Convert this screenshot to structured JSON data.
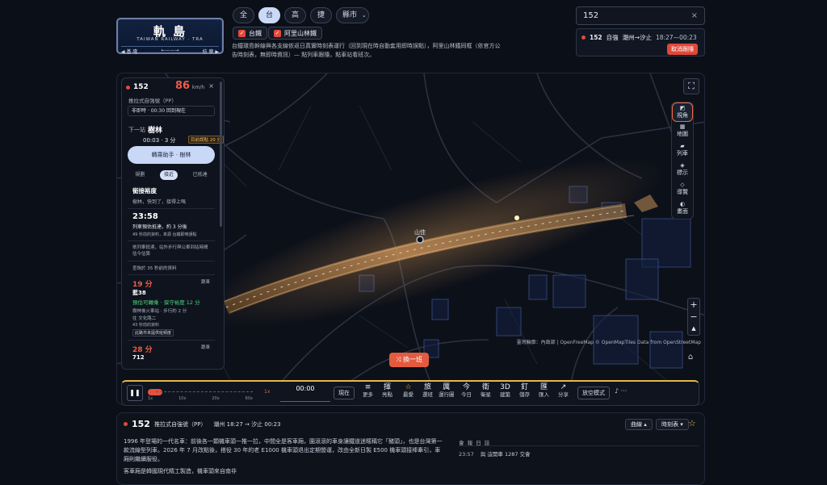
{
  "logo": {
    "title": "軌 島",
    "subtitle": "TAIWAN RAILWAY · TRA",
    "left_station": "◀ 基 隆",
    "arrow": "←——→",
    "right_station": "枋 寮 ▶"
  },
  "filters": {
    "all": "全",
    "tra": "台",
    "hsr": "高",
    "metro": "捷",
    "city": "縣市",
    "city_icon": "chevron-down"
  },
  "checks": {
    "tra": "台鐵",
    "alishan": "阿里山林鐵"
  },
  "description": "台鐵環島幹線與各支線依返日真實時刻表運行（回到現在時自動套用即時誤點），阿里山林鐵同框（依官方公告時刻表，無即時資訊）— 點列車跟隨，點車站看班次。",
  "search": {
    "value": "152",
    "clear": "×"
  },
  "result": {
    "train": "152",
    "type": "自強",
    "route": "潮州→汐止",
    "time": "18:27—00:23",
    "cancel": "取消跟隨"
  },
  "side": {
    "train": "152",
    "speed": "86",
    "speed_unit": "km/h",
    "close": "×",
    "train_type": "推拉式自強號（PP）",
    "realtime": "非即時 · 00:30",
    "realtime_link": "回到現在",
    "next_label": "下一站",
    "next_station": "樹林",
    "eta": "00:03 · 3 分",
    "delay": "目前誤點 20 分",
    "assist": "轉乘助手 · 樹林",
    "tabs": [
      "規劃",
      "接近",
      "已抵達"
    ],
    "card1_title": "銜接裕度",
    "card1_text": "樹林，快到了，接得上嗎",
    "time1": "23:58",
    "time1_sub": "列車預估抵達，約 3 分後",
    "time1_note": "49 秒前的資料，來源 台鐵即時誤點",
    "note2": "依列車抵達，站外步行與公車到站時間估今估算",
    "note3": "查詢於 35 秒前的資料",
    "bus1_min": "19 分",
    "bus1_tag": "跟車",
    "bus1_no": "藍38",
    "bus1_ok": "預估可轉乘 · 保守裕度 12 分",
    "bus1_walk": "樹林後火車站 · 步行約 2 分",
    "bus1_dest": "往 文化路二",
    "bus1_note": "43 秒前的資料",
    "bus1_btn": "此路市未提供班頻度",
    "bus2_min": "28 分",
    "bus2_tag": "跟車",
    "bus2_no": "712"
  },
  "map": {
    "station_label": "山佳",
    "attribution": "臺灣輪廓：內政部 | OpenFreeMap © OpenMapTiles Data from OpenStreetMap",
    "switch_button": "換一班",
    "fullscreen_icon": "fullscreen-icon",
    "zoom_in": "+",
    "zoom_out": "−",
    "compass": "▲",
    "locate": "⌂"
  },
  "rail": [
    {
      "icon": "◩",
      "label": "視角"
    },
    {
      "icon": "▦",
      "label": "地圖"
    },
    {
      "icon": "▰",
      "label": "列車"
    },
    {
      "icon": "◈",
      "label": "標示"
    },
    {
      "icon": "◇",
      "label": "導覽"
    },
    {
      "icon": "◐",
      "label": "畫面"
    }
  ],
  "player": {
    "speed_ticks": [
      "1x",
      "10x",
      "20x",
      "60x"
    ],
    "speed_value": "1x",
    "time": "00:00",
    "now": "現在",
    "tools": [
      {
        "icon": "≡",
        "label": "更多"
      },
      {
        "icon": "揮",
        "label": "亮點"
      },
      {
        "icon": "☆",
        "label": "最愛"
      },
      {
        "icon": "旅",
        "label": "選班"
      },
      {
        "icon": "厲",
        "label": "運行圖"
      },
      {
        "icon": "今",
        "label": "今日"
      },
      {
        "icon": "衛",
        "label": "衛星"
      },
      {
        "icon": "3D",
        "label": "建築"
      },
      {
        "icon": "釘",
        "label": "儲存"
      },
      {
        "icon": "匯",
        "label": "匯入"
      },
      {
        "icon": "↗",
        "label": "分享"
      }
    ],
    "free_mode": "放空模式",
    "music": "♪ ···"
  },
  "detail": {
    "train": "152",
    "type": "推拉式自強號（PP）",
    "route": "潮州 18:27 → 汐止 00:23",
    "curve_btn": "曲線 ▴",
    "timetable_btn": "時刻表 ▾",
    "star": "☆",
    "text1": "1996 年登場的一代名車：前後各一顆機車頭一推一拉，中間全是客車廂，園滾滾的車身讓鐵道迷暱稱它「豬頭」，也是台灣第一款流線型列車。2026 年 7 月改點後，搭役 30 年的老 E1000 機車頭退出定期營運，改由全新日製 E500 機車頭接棒牽引，車廂則繼續服役。",
    "text2": "客車廂是韓國現代精工製造，機車頭來自南非",
    "log_title": "會 報 日 誌",
    "log_time": "23:57",
    "log_text": "與 這開車 1287 交會"
  }
}
